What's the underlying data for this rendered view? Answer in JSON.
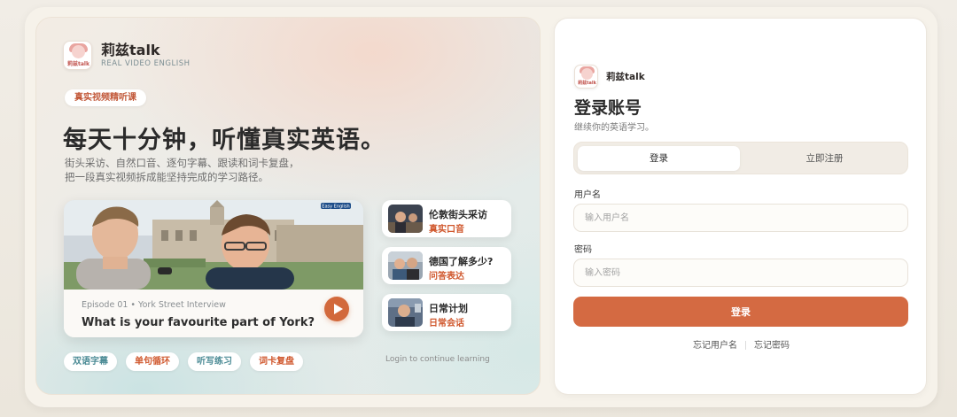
{
  "brand": {
    "name": "莉兹talk",
    "subtitle": "REAL VIDEO ENGLISH",
    "logo_tag": "莉兹talk"
  },
  "hero": {
    "tag": "真实视频精听课",
    "headline": "每天十分钟，听懂真实英语。",
    "description_line1": "街头采访、自然口音、逐句字幕、跟读和词卡复盘，",
    "description_line2": "把一段真实视频拆成能坚持完成的学习路径。",
    "featured_video": {
      "episode": "Episode 01 • York Street Interview",
      "title": "What is your favourite part of York?",
      "thumb_caption": "Easy English"
    },
    "side_videos": [
      {
        "title": "伦敦街头采访",
        "subtitle": "真实口音"
      },
      {
        "title": "德国了解多少?",
        "subtitle": "问答表达"
      },
      {
        "title": "日常计划",
        "subtitle": "日常会话"
      }
    ],
    "features": [
      "双语字幕",
      "单句循环",
      "听写练习",
      "词卡复盘"
    ],
    "hint": "Login to continue learning"
  },
  "login": {
    "brand_name": "莉兹talk",
    "title": "登录账号",
    "subtitle": "继续你的英语学习。",
    "tabs": [
      {
        "label": "登录",
        "active": true
      },
      {
        "label": "立即注册",
        "active": false
      }
    ],
    "username_label": "用户名",
    "username_placeholder": "输入用户名",
    "username_value": "",
    "password_label": "密码",
    "password_placeholder": "输入密码",
    "password_value": "",
    "submit_label": "登录",
    "forgot_username": "忘记用户名",
    "forgot_password": "忘记密码"
  },
  "colors": {
    "accent": "#d46a42",
    "accent_text": "#d0582e",
    "teal_text": "#4d8c96"
  },
  "icons": {
    "play": "play-icon",
    "logo": "brand-logo-icon"
  }
}
